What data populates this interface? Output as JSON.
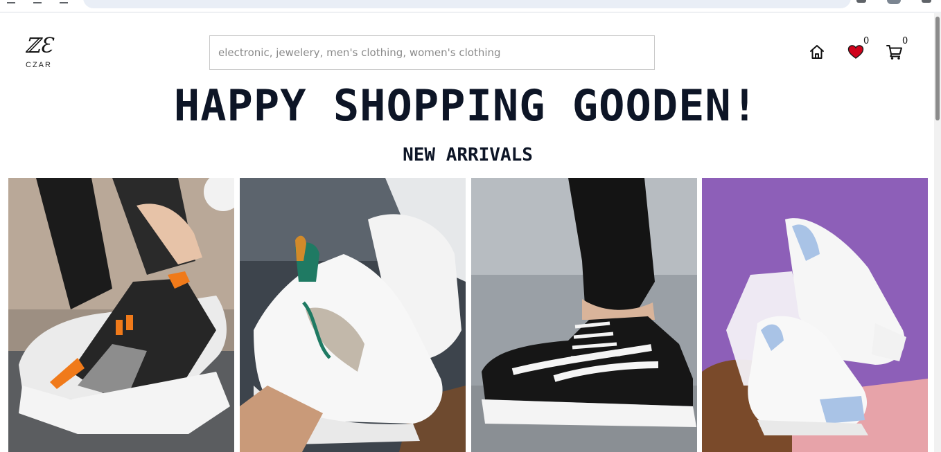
{
  "header": {
    "logo_mark": "ℤƐ",
    "logo_name": "CZAR",
    "search_placeholder": "electronic, jewelery, men's clothing, women's clothing",
    "wishlist_count": "0",
    "cart_count": "0"
  },
  "hero": {
    "title": "HAPPY SHOPPING GOODEN!",
    "subtitle": "NEW ARRIVALS"
  },
  "products": [
    {
      "image": "chunky-black-grey-sneaker-photo",
      "accent": "#f07a1a"
    },
    {
      "image": "white-green-mustard-sneaker-photo",
      "accent": "#1f7a63"
    },
    {
      "image": "black-white-canvas-sneaker-photo",
      "accent": "#111111"
    },
    {
      "image": "white-lightblue-sneaker-photo",
      "accent": "#a9c3e6"
    }
  ],
  "colors": {
    "heading": "#0d1526",
    "heart": "#d0021b",
    "search_border": "#c9c9c9"
  }
}
